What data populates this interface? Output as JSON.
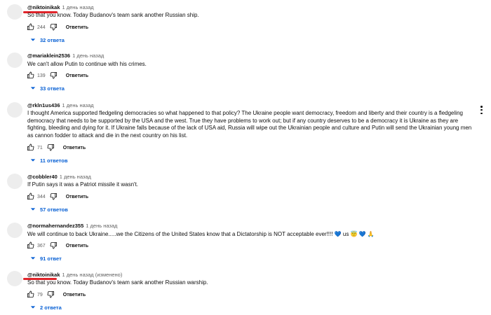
{
  "reply_label": "Ответить",
  "comments": [
    {
      "author": "@niktoinikak",
      "time": "1 день назад",
      "text": "So that you know. Today Budanov's team sank another Russian ship.",
      "likes": "244",
      "replies": "32 ответа",
      "highlighted": true
    },
    {
      "author": "@mariaklein2536",
      "time": "1 день назад",
      "text": "We can't allow Putin to continue with his crimes.",
      "likes": "139",
      "replies": "33 ответа"
    },
    {
      "author": "@rkln1us436",
      "time": "1 день назад",
      "text": "I thought America supported fledgeling democracies so what happened to that policy? The Ukraine people want democracy, freedom and liberty and their country is a fledgeling democracy that needs to be supported by the USA and the west.  True they have problems to work out; but if any country deserves to be a democracy it is Ukraine as they are fighting, bleeding and dying for it.  If Ukraine falls because of the lack of USA aid, Russia will wipe out the Ukrainian  people and culture and Putin will send the Ukrainian young men as cannon fodder to attack and die in the next country on his list.",
      "likes": "71",
      "replies": "11 ответов"
    },
    {
      "author": "@cobbler40",
      "time": "1 день назад",
      "text": "If Putin says it was a Patriot missile it wasn't.",
      "likes": "344",
      "replies": "57 ответов"
    },
    {
      "author": "@normahernandez355",
      "time": "1 день назад",
      "text": "We will continue to back Ukraine.....we the Citizens of the United States know that a Dictatorship is NOT acceptable ever!!!!  💙 us 😇 💙 🙏",
      "likes": "367",
      "replies": "91 ответ"
    },
    {
      "author": "@niktoinikak",
      "time": "1 день назад (изменено)",
      "text": "So that you know. Today Budanov's team sank another Russian warship.",
      "likes": "79",
      "replies": "2 ответа",
      "highlighted": true
    }
  ]
}
